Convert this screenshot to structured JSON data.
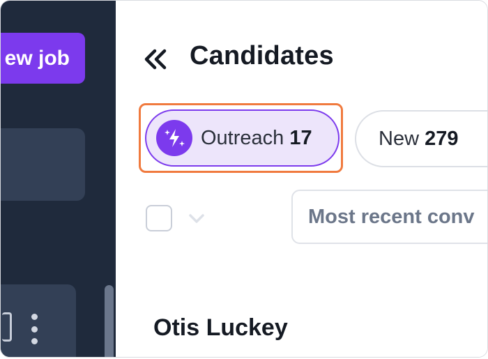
{
  "sidebar": {
    "new_job_label": "ew job"
  },
  "header": {
    "title": "Candidates"
  },
  "filters": {
    "outreach": {
      "label": "Outreach",
      "count": "17"
    },
    "new": {
      "label": "New",
      "count": "279"
    }
  },
  "toolbar": {
    "sort_value": "Most recent conv"
  },
  "candidates": [
    {
      "name": "Otis Luckey"
    }
  ],
  "colors": {
    "accent": "#7c3aed",
    "highlight": "#f07a3e",
    "sidebar_bg": "#1f2a3c"
  }
}
